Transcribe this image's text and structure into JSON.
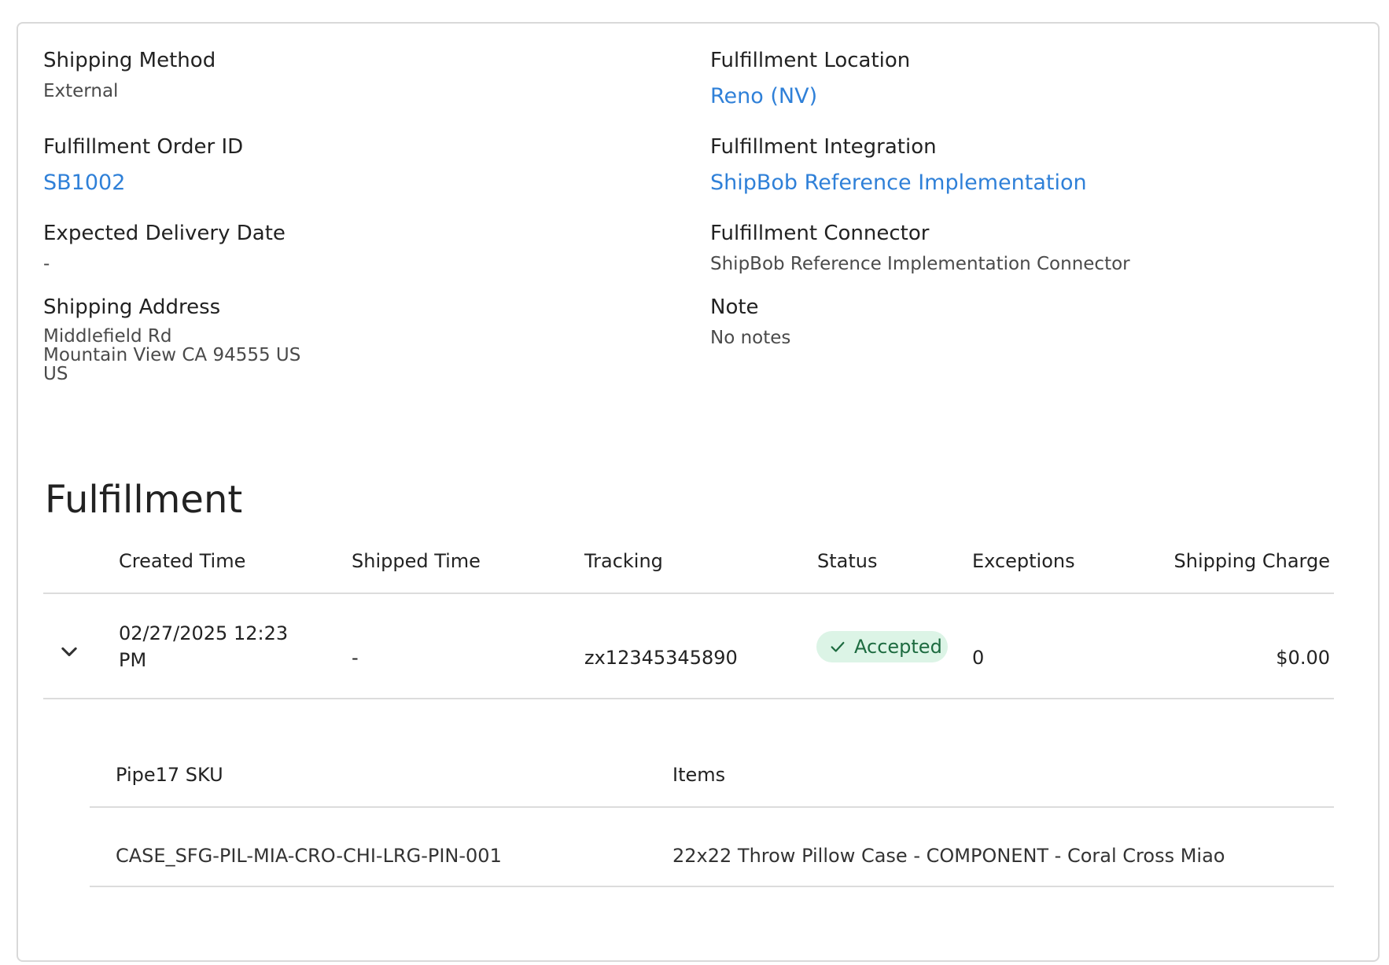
{
  "details": {
    "shipping_method": {
      "label": "Shipping Method",
      "value": "External"
    },
    "fulfillment_location": {
      "label": "Fulfillment Location",
      "value": "Reno (NV)"
    },
    "fulfillment_order_id": {
      "label": "Fulfillment Order ID",
      "value": "SB1002"
    },
    "fulfillment_integration": {
      "label": "Fulfillment Integration",
      "value": "ShipBob Reference Implementation"
    },
    "expected_delivery_date": {
      "label": "Expected Delivery Date",
      "value": "-"
    },
    "fulfillment_connector": {
      "label": "Fulfillment Connector",
      "value": "ShipBob Reference Implementation Connector"
    },
    "shipping_address": {
      "label": "Shipping Address",
      "lines": [
        "Middlefield Rd",
        "Mountain View CA 94555 US",
        "US"
      ]
    },
    "note": {
      "label": "Note",
      "value": "No notes"
    }
  },
  "fulfillment": {
    "title": "Fulfillment",
    "columns": [
      "Created Time",
      "Shipped Time",
      "Tracking",
      "Status",
      "Exceptions",
      "Shipping Charge"
    ],
    "rows": [
      {
        "created_time_line1": "02/27/2025 12:23",
        "created_time_line2": "PM",
        "shipped_time": "-",
        "tracking": "zx12345345890",
        "status": "Accepted",
        "exceptions": "0",
        "shipping_charge": "$0.00"
      }
    ],
    "items_table": {
      "columns": [
        "Pipe17 SKU",
        "Items"
      ],
      "rows": [
        {
          "sku": "CASE_SFG-PIL-MIA-CRO-CHI-LRG-PIN-001",
          "item": "22x22 Throw Pillow Case - COMPONENT - Coral Cross Miao"
        }
      ]
    }
  },
  "colors": {
    "link": "#2f80d8",
    "status_bg": "#dcf4e6",
    "status_text": "#1d6b40",
    "border": "#d9d9d9"
  },
  "icons": {
    "expand": "chevron-down-icon",
    "status": "check-icon"
  }
}
